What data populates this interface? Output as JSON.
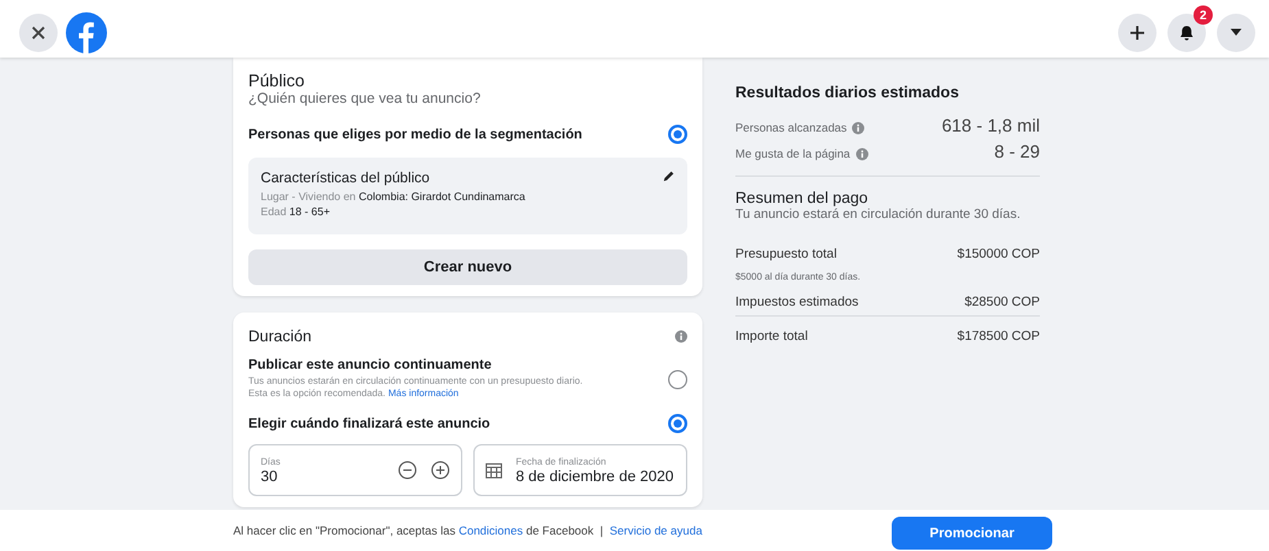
{
  "topbar": {
    "notification_count": "2"
  },
  "audience": {
    "title": "Público",
    "subtitle": "¿Quién quieres que vea tu anuncio?",
    "option": {
      "label": "Personas que eliges por medio de la segmentación",
      "selected": true
    },
    "card": {
      "title": "Características del público",
      "location_prefix": "Lugar - Viviendo en",
      "location": "Colombia: Girardot Cundinamarca",
      "age_prefix": "Edad",
      "age": "18 - 65+"
    },
    "button": "Crear nuevo"
  },
  "duration": {
    "title": "Duración",
    "options": [
      {
        "label": "Publicar este anuncio continuamente",
        "description": "Tus anuncios estarán en circulación continuamente con un presupuesto diario.",
        "description_2": "Esta es la opción recomendada.",
        "link": "Más información",
        "selected": false
      },
      {
        "label": "Elegir cuándo finalizará este anuncio",
        "selected": true
      }
    ],
    "days": {
      "label": "Días",
      "value": "30"
    },
    "end_date": {
      "label": "Fecha de finalización",
      "value": "8 de diciembre de 2020"
    }
  },
  "results": {
    "title": "Resultados diarios estimados",
    "rows": [
      {
        "label": "Personas alcanzadas",
        "value": "618 - 1,8 mil"
      },
      {
        "label": "Me gusta de la página",
        "value": "8 - 29"
      }
    ]
  },
  "payment": {
    "title": "Resumen del pago",
    "subtitle": "Tu anuncio estará en circulación durante 30 días.",
    "rows": [
      {
        "label": "Presupuesto total",
        "note": "$5000 al día durante 30 días.",
        "value": "$150000 COP"
      },
      {
        "label": "Impuestos estimados",
        "value": "$28500 COP"
      }
    ],
    "total": {
      "label": "Importe total",
      "value": "$178500 COP"
    }
  },
  "footer": {
    "text_before": "Al hacer clic en \"Promocionar\", aceptas las",
    "terms_link": "Condiciones",
    "text_after": "de Facebook",
    "separator": "|",
    "help_link": "Servicio de ayuda",
    "button": "Promocionar"
  }
}
